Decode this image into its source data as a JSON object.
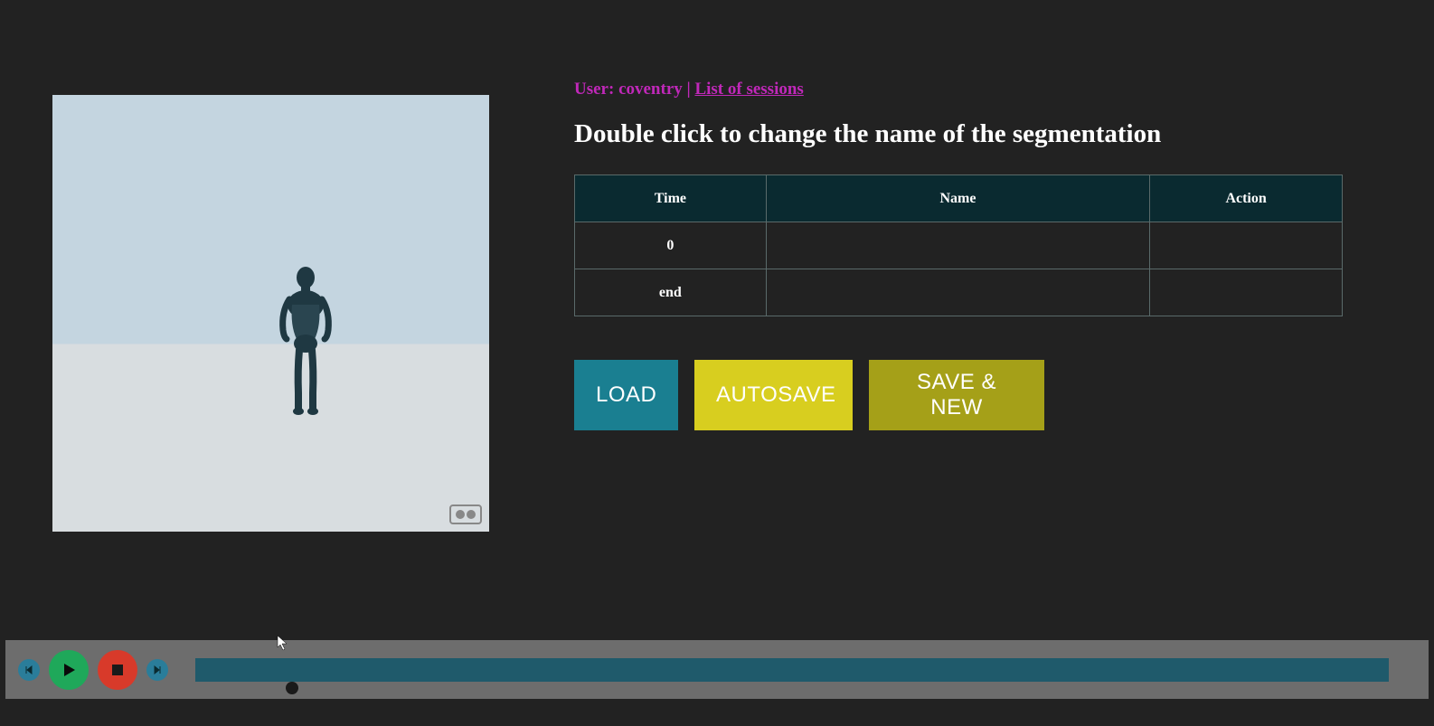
{
  "user": {
    "prefix": "User: ",
    "name": "coventry",
    "separator": " | ",
    "link_label": "List of sessions"
  },
  "heading": "Double click to change the name of the segmentation",
  "table": {
    "headers": {
      "time": "Time",
      "name": "Name",
      "action": "Action"
    },
    "rows": [
      {
        "time": "0",
        "name": "",
        "action": ""
      },
      {
        "time": "end",
        "name": "",
        "action": ""
      }
    ]
  },
  "buttons": {
    "load": "LOAD",
    "autosave": "AUTOSAVE",
    "savenew": "SAVE & NEW"
  },
  "timeline": {
    "icons": {
      "prev": "prev",
      "play": "play",
      "stop": "stop",
      "next": "next"
    }
  }
}
